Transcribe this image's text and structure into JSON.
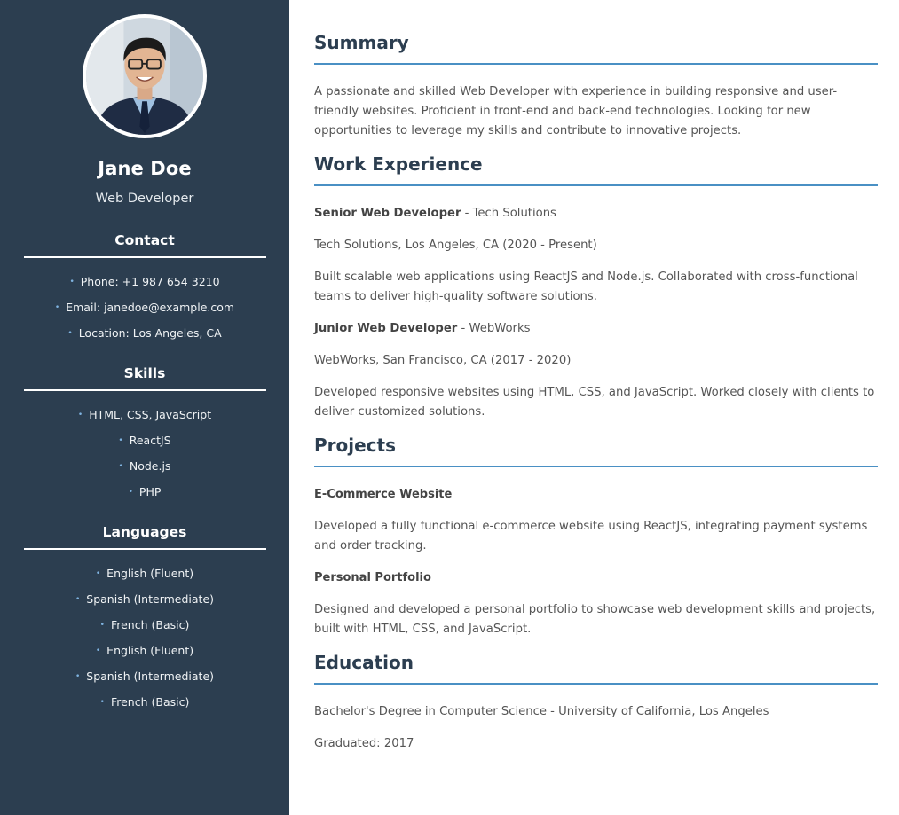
{
  "profile": {
    "name": "Jane Doe",
    "title": "Web Developer"
  },
  "contact": {
    "heading": "Contact",
    "items": [
      "Phone: +1 987 654 3210",
      "Email: janedoe@example.com",
      "Location: Los Angeles, CA"
    ]
  },
  "skills": {
    "heading": "Skills",
    "items": [
      "HTML, CSS, JavaScript",
      "ReactJS",
      "Node.js",
      "PHP"
    ]
  },
  "languages": {
    "heading": "Languages",
    "items": [
      "English (Fluent)",
      "Spanish (Intermediate)",
      "French (Basic)",
      "English (Fluent)",
      "Spanish (Intermediate)",
      "French (Basic)"
    ]
  },
  "summary": {
    "heading": "Summary",
    "text": "A passionate and skilled Web Developer with experience in building responsive and user-friendly websites. Proficient in front-end and back-end technologies. Looking for new opportunities to leverage my skills and contribute to innovative projects."
  },
  "work": {
    "heading": "Work Experience",
    "jobs": [
      {
        "role": "Senior Web Developer",
        "company": " - Tech Solutions",
        "location": "Tech Solutions, Los Angeles, CA (2020 - Present)",
        "description": "Built scalable web applications using ReactJS and Node.js. Collaborated with cross-functional teams to deliver high-quality software solutions."
      },
      {
        "role": "Junior Web Developer",
        "company": " - WebWorks",
        "location": "WebWorks, San Francisco, CA (2017 - 2020)",
        "description": "Developed responsive websites using HTML, CSS, and JavaScript. Worked closely with clients to deliver customized solutions."
      }
    ]
  },
  "projects": {
    "heading": "Projects",
    "items": [
      {
        "name": "E-Commerce Website",
        "description": "Developed a fully functional e-commerce website using ReactJS, integrating payment systems and order tracking."
      },
      {
        "name": "Personal Portfolio",
        "description": "Designed and developed a personal portfolio to showcase web development skills and projects, built with HTML, CSS, and JavaScript."
      }
    ]
  },
  "education": {
    "heading": "Education",
    "degree": "Bachelor's Degree in Computer Science - University of California, Los Angeles",
    "graduated": "Graduated: 2017"
  },
  "colors": {
    "sidebar": "#2c3e50",
    "accent": "#4a90c4",
    "heading": "#2c3e50"
  }
}
